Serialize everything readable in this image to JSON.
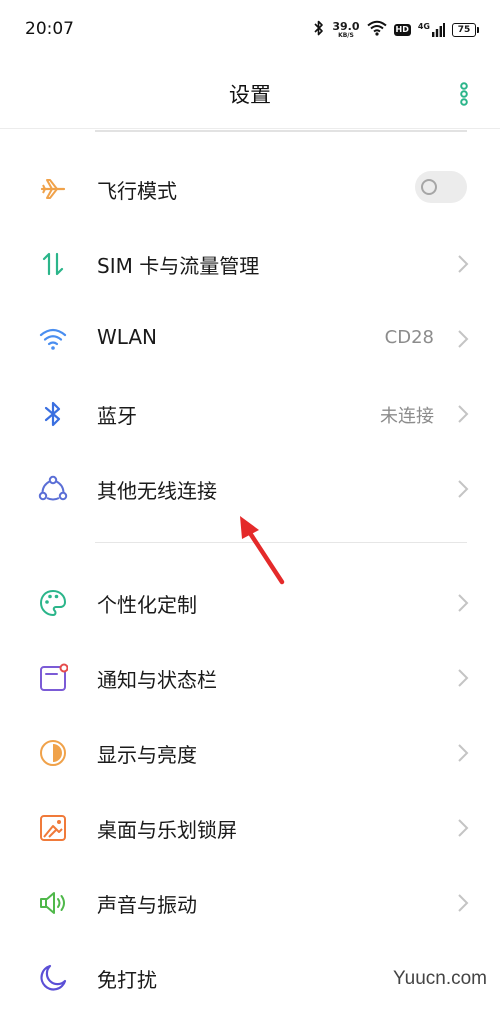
{
  "status_bar": {
    "time": "20:07",
    "net_speed_value": "39.0",
    "net_speed_unit": "KB/S",
    "hd_badge": "HD",
    "network_type": "4G",
    "battery": "75"
  },
  "header": {
    "title": "设置",
    "more_icon": "vertical-dots-icon",
    "accent_color": "#2bb58a"
  },
  "sections": [
    {
      "items": [
        {
          "label": "飞行模式",
          "icon": "airplane-icon",
          "control": "toggle",
          "toggle_on": false
        },
        {
          "label": "SIM 卡与流量管理",
          "icon": "sim-data-icon",
          "control": "chevron"
        },
        {
          "label": "WLAN",
          "icon": "wifi-icon",
          "value": "CD28",
          "control": "chevron"
        },
        {
          "label": "蓝牙",
          "icon": "bluetooth-icon",
          "value": "未连接",
          "control": "chevron"
        },
        {
          "label": "其他无线连接",
          "icon": "connection-nodes-icon",
          "control": "chevron"
        }
      ]
    },
    {
      "items": [
        {
          "label": "个性化定制",
          "icon": "palette-icon",
          "control": "chevron"
        },
        {
          "label": "通知与状态栏",
          "icon": "notification-icon",
          "control": "chevron"
        },
        {
          "label": "显示与亮度",
          "icon": "brightness-icon",
          "control": "chevron"
        },
        {
          "label": "桌面与乐划锁屏",
          "icon": "wallpaper-icon",
          "control": "chevron"
        },
        {
          "label": "声音与振动",
          "icon": "speaker-icon",
          "control": "chevron"
        },
        {
          "label": "免打扰",
          "icon": "moon-icon",
          "control": "chevron"
        }
      ]
    }
  ],
  "watermark": "Yuucn.com"
}
